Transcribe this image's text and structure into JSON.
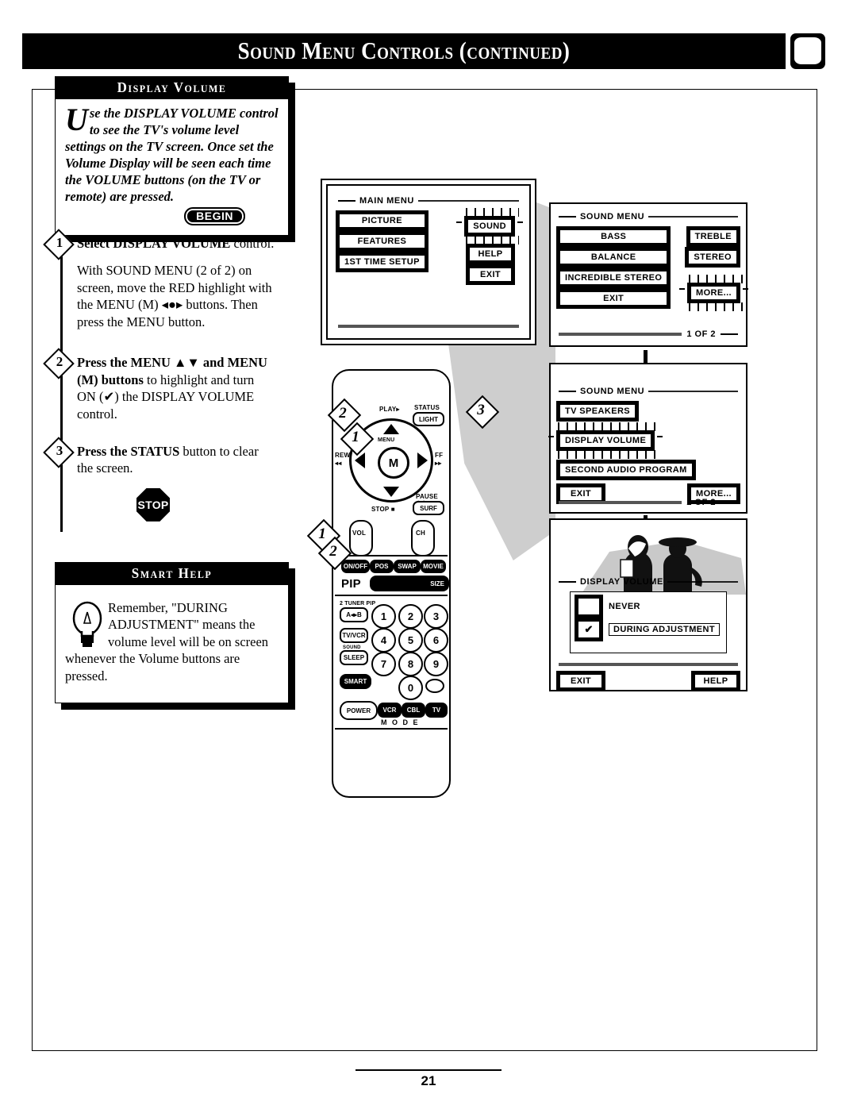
{
  "header": {
    "title": "Sound Menu Controls (continued)",
    "tv_icon": "tv-icon"
  },
  "intro_panel": {
    "heading": "Display Volume",
    "dropcap": "U",
    "body": "se the DISPLAY VOLUME control to see the TV's volume level settings on the TV screen. Once set  the Volume Display will be seen each time the VOLUME buttons (on the TV or remote) are pressed.",
    "begin_badge": "BEGIN"
  },
  "steps": [
    {
      "number": "1",
      "lead": "Select DISPLAY VOLUME",
      "rest": " control.",
      "paragraph": "With SOUND MENU (2 of 2) on screen, move the RED highlight with the MENU (M) ◂●▸ buttons. Then press the MENU button."
    },
    {
      "number": "2",
      "lead": "Press the MENU ▲▼ and MENU (M) buttons",
      "rest": " to highlight and turn ON (✔) the DISPLAY VOLUME control.",
      "paragraph": ""
    },
    {
      "number": "3",
      "lead": "Press the STATUS",
      "rest": " button to clear the screen.",
      "paragraph": ""
    }
  ],
  "stop_badge": "STOP",
  "smart_help": {
    "heading": "Smart Help",
    "icon": "lightbulb-icon",
    "body": "Remember, \"DURING ADJUSTMENT\" means the volume level will be on screen whenever the Volume buttons are pressed."
  },
  "screens": {
    "main_menu": {
      "title": "MAIN MENU",
      "left_buttons": [
        "PICTURE",
        "FEATURES",
        "1ST TIME SETUP"
      ],
      "right_buttons": [
        "SOUND",
        "HELP",
        "EXIT"
      ],
      "highlighted": "SOUND"
    },
    "sound_menu_1": {
      "title": "SOUND MENU",
      "left_buttons": [
        "BASS",
        "BALANCE",
        "INCREDIBLE STEREO",
        "EXIT"
      ],
      "right_buttons": [
        "TREBLE",
        "STEREO",
        "MORE..."
      ],
      "highlighted": "MORE...",
      "page_label": "1 OF 2"
    },
    "sound_menu_2": {
      "title": "SOUND MENU",
      "buttons": [
        "TV SPEAKERS",
        "DISPLAY VOLUME",
        "SECOND AUDIO PROGRAM"
      ],
      "exit_label": "EXIT",
      "more_label": "MORE...",
      "highlighted": "DISPLAY VOLUME",
      "page_label": "2 OF 2"
    },
    "display_volume": {
      "title": "DISPLAY VOLUME",
      "options": [
        {
          "label": "NEVER",
          "checked": ""
        },
        {
          "label": "DURING ADJUSTMENT",
          "checked": "✔"
        }
      ],
      "exit_label": "EXIT",
      "help_label": "HELP"
    }
  },
  "remote": {
    "callouts": [
      "1",
      "2",
      "3",
      "1",
      "2"
    ],
    "center_label": "M",
    "menu_label": "MENU",
    "labels": {
      "play": "PLAY▸",
      "rew": "REW",
      "rew_icon": "◂◂",
      "ff": "FF",
      "ff_icon": "▸▸",
      "stop": "STOP ■",
      "pause": "PAUSE ❙❙",
      "status": "STATUS",
      "light": "LIGHT",
      "surf": "SURF",
      "vol": "VOL",
      "ch": "CH",
      "pip": "PIP",
      "size": "SIZE",
      "on_off": "ON/OFF",
      "pos": "POS",
      "swap": "SWAP",
      "movie": "MOVIE",
      "two_tuner_pip": "2 TUNER PIP",
      "ab_swap": "A◂▸B",
      "tv_vcr": "TV/VCR",
      "smart_sound": "SOUND",
      "sleep": "SLEEP",
      "smart": "SMART",
      "power": "POWER",
      "vcr": "VCR",
      "cbl": "CBL",
      "tv": "TV",
      "mode": "M  O  D  E"
    },
    "keypad": [
      "1",
      "2",
      "3",
      "4",
      "5",
      "6",
      "7",
      "8",
      "9",
      "0"
    ]
  },
  "footer": {
    "page_number": "21"
  }
}
